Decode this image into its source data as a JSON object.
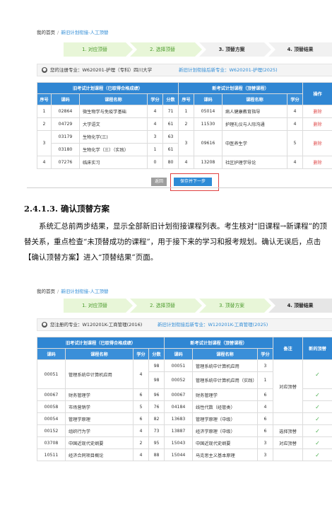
{
  "screen1": {
    "breadcrumb": {
      "home": "我的首页",
      "sep": "/",
      "current": "新旧计划衔接-人工顶替"
    },
    "steps": [
      "1. 对应顶替",
      "2. 选择顶替",
      "3. 顶替方案",
      "4. 顶替结果"
    ],
    "info": {
      "left": "您的注册专业：W620201-护理（专科）四川大学",
      "right": "新旧计划衔接后新专业：W620201-护理(2025)"
    },
    "old_title": "旧考试计划课程（已取得合格成绩）",
    "new_title": "新考试计划课程（顶替课程）",
    "operate": "操作",
    "headers_old": [
      "序号",
      "课码",
      "课程名称",
      "学分",
      "分数"
    ],
    "headers_new": [
      "序号",
      "课码",
      "课程名称",
      "学分"
    ],
    "rows": [
      {
        "old": [
          [
            "1",
            "02864",
            "微生物学与免疫学基础",
            "4",
            "71"
          ]
        ],
        "new": [
          "1",
          "05014",
          "病人健康教育指导",
          "4"
        ],
        "op": "删除"
      },
      {
        "old": [
          [
            "2",
            "04729",
            "大学语文",
            "4",
            "61"
          ]
        ],
        "new": [
          "2",
          "11530",
          "护理礼仪与人际沟通",
          "4"
        ],
        "op": "删除"
      },
      {
        "old": [
          [
            "",
            "03179",
            "生物化学(三)",
            "3",
            "63"
          ],
          [
            "3",
            "03180",
            "生物化学（三）（实践）",
            "1",
            "61"
          ]
        ],
        "new": [
          "3",
          "09616",
          "中医养生学",
          "5"
        ],
        "op": "删除"
      },
      {
        "old": [
          [
            "4",
            "07276",
            "临床实习",
            "0",
            "80"
          ]
        ],
        "new": [
          "4",
          "13208",
          "社区护理学导论",
          "4"
        ],
        "op": "删除"
      }
    ],
    "buttons": {
      "back": "返回",
      "next": "保存并下一步"
    }
  },
  "section": {
    "heading": "2.4.1.3. 确认顶替方案",
    "para": "系统汇总前两步结果，显示全部新旧计划衔接课程列表。考生核对“旧课程→新课程”的顶替关系，重点检查“未顶替成功的课程”，用于接下来的学习和报考规划。确认无误后，点击【确认顶替方案】进入“顶替结果”页面。"
  },
  "screen2": {
    "breadcrumb": {
      "home": "我的首页",
      "sep": "/",
      "current": "新旧计划衔接-人工顶替"
    },
    "steps": [
      "1. 对应顶替",
      "2. 选择顶替",
      "3. 顶替方案",
      "4. 顶替结果"
    ],
    "info": {
      "left": "您注册的专业：W120201K-工商管理(2016)",
      "right": "新旧计划衔接后新专业：W120201K-工商管理(2025)"
    },
    "old_title": "旧考试计划课程（已取得合格成绩）",
    "new_title": "新考试计划课程（顶替课程）",
    "remark": "备注",
    "new_flag": "新的顶替",
    "headers_old": [
      "课码",
      "课程名称",
      "学分",
      "分数"
    ],
    "headers_new": [
      "课码",
      "课程名称",
      "学分"
    ],
    "rows": [
      {
        "old": [
          "00051",
          "管理系统中计算机应用",
          "4"
        ],
        "scores": [
          "98",
          "98"
        ],
        "new": [
          [
            "00051",
            "管理系统中计算机应用",
            "3"
          ],
          [
            "00052",
            "管理系统中计算机应用（实践）",
            "1"
          ]
        ],
        "remark": "",
        "check": "✓"
      },
      {
        "old": [
          "00067",
          "财务管理学",
          "6"
        ],
        "scores": [
          "96"
        ],
        "new": [
          [
            "00067",
            "财务管理学",
            "6"
          ]
        ],
        "remark": "对应顶替",
        "check": "✓"
      },
      {
        "old": [
          "00058",
          "市场营销学",
          "5"
        ],
        "scores": [
          "76"
        ],
        "new": [
          [
            "04184",
            "线性代数（经管类）",
            "4"
          ]
        ],
        "remark": "",
        "check": "✓"
      },
      {
        "old": [
          "00054",
          "管理学原理",
          "6"
        ],
        "scores": [
          "82"
        ],
        "new": [
          [
            "13683",
            "管理学原理（中级）",
            "6"
          ]
        ],
        "remark": "",
        "check": "✓"
      },
      {
        "old": [
          "00152",
          "组织行为学",
          "4"
        ],
        "scores": [
          "73"
        ],
        "new": [
          [
            "13887",
            "经济学原理（中级）",
            "6"
          ]
        ],
        "remark": "选择顶替",
        "check": "✓"
      },
      {
        "old": [
          "03708",
          "中国近现代史纲要",
          "2"
        ],
        "scores": [
          "95"
        ],
        "new": [
          [
            "15043",
            "中国近现代史纲要",
            "3"
          ]
        ],
        "remark": "对应顶替",
        "check": "✓"
      },
      {
        "old": [
          "10511",
          "经济合同项目概论",
          "4"
        ],
        "scores": [
          "88"
        ],
        "new": [
          [
            "15044",
            "马克思主义基本原理",
            "3"
          ]
        ],
        "remark": "",
        "check": "✓"
      }
    ]
  }
}
